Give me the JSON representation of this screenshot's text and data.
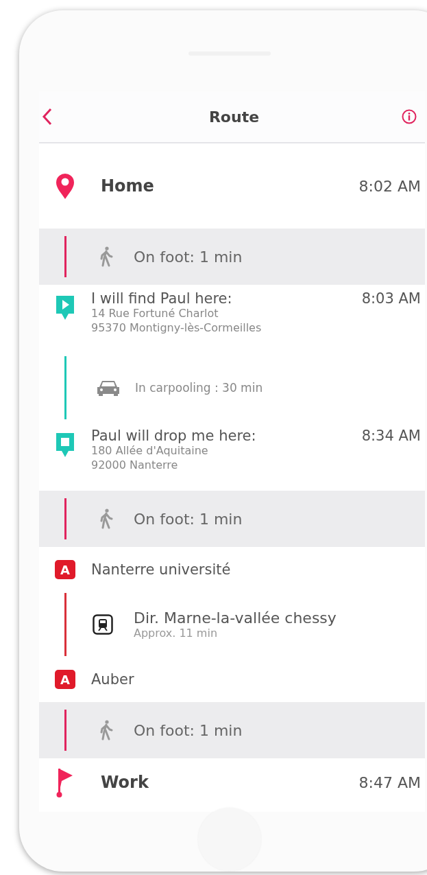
{
  "header": {
    "title": "Route"
  },
  "steps": [
    {
      "kind": "origin",
      "label": "Home",
      "time": "8:02 AM"
    },
    {
      "kind": "walk",
      "label": "On foot: 1 min"
    },
    {
      "kind": "pickup",
      "label": "I will find Paul here:",
      "time": "8:03 AM",
      "address": [
        "14 Rue Fortuné Charlot",
        "95370 Montigny-lès-Cormeilles"
      ]
    },
    {
      "kind": "ride",
      "label": "In carpooling : 30 min"
    },
    {
      "kind": "dropoff",
      "label": "Paul will drop me here:",
      "time": "8:34 AM",
      "address": [
        "180 Allée d'Aquitaine",
        "92000 Nanterre"
      ]
    },
    {
      "kind": "walk",
      "label": "On foot: 1 min"
    },
    {
      "kind": "station",
      "badge": "A",
      "label": "Nanterre université"
    },
    {
      "kind": "transit",
      "label": "Dir. Marne-la-vallée chessy",
      "detail": "Approx. 11 min"
    },
    {
      "kind": "station",
      "badge": "A",
      "label": "Auber"
    },
    {
      "kind": "walk",
      "label": "On foot: 1 min"
    },
    {
      "kind": "destination",
      "label": "Work",
      "time": "8:47 AM"
    }
  ]
}
